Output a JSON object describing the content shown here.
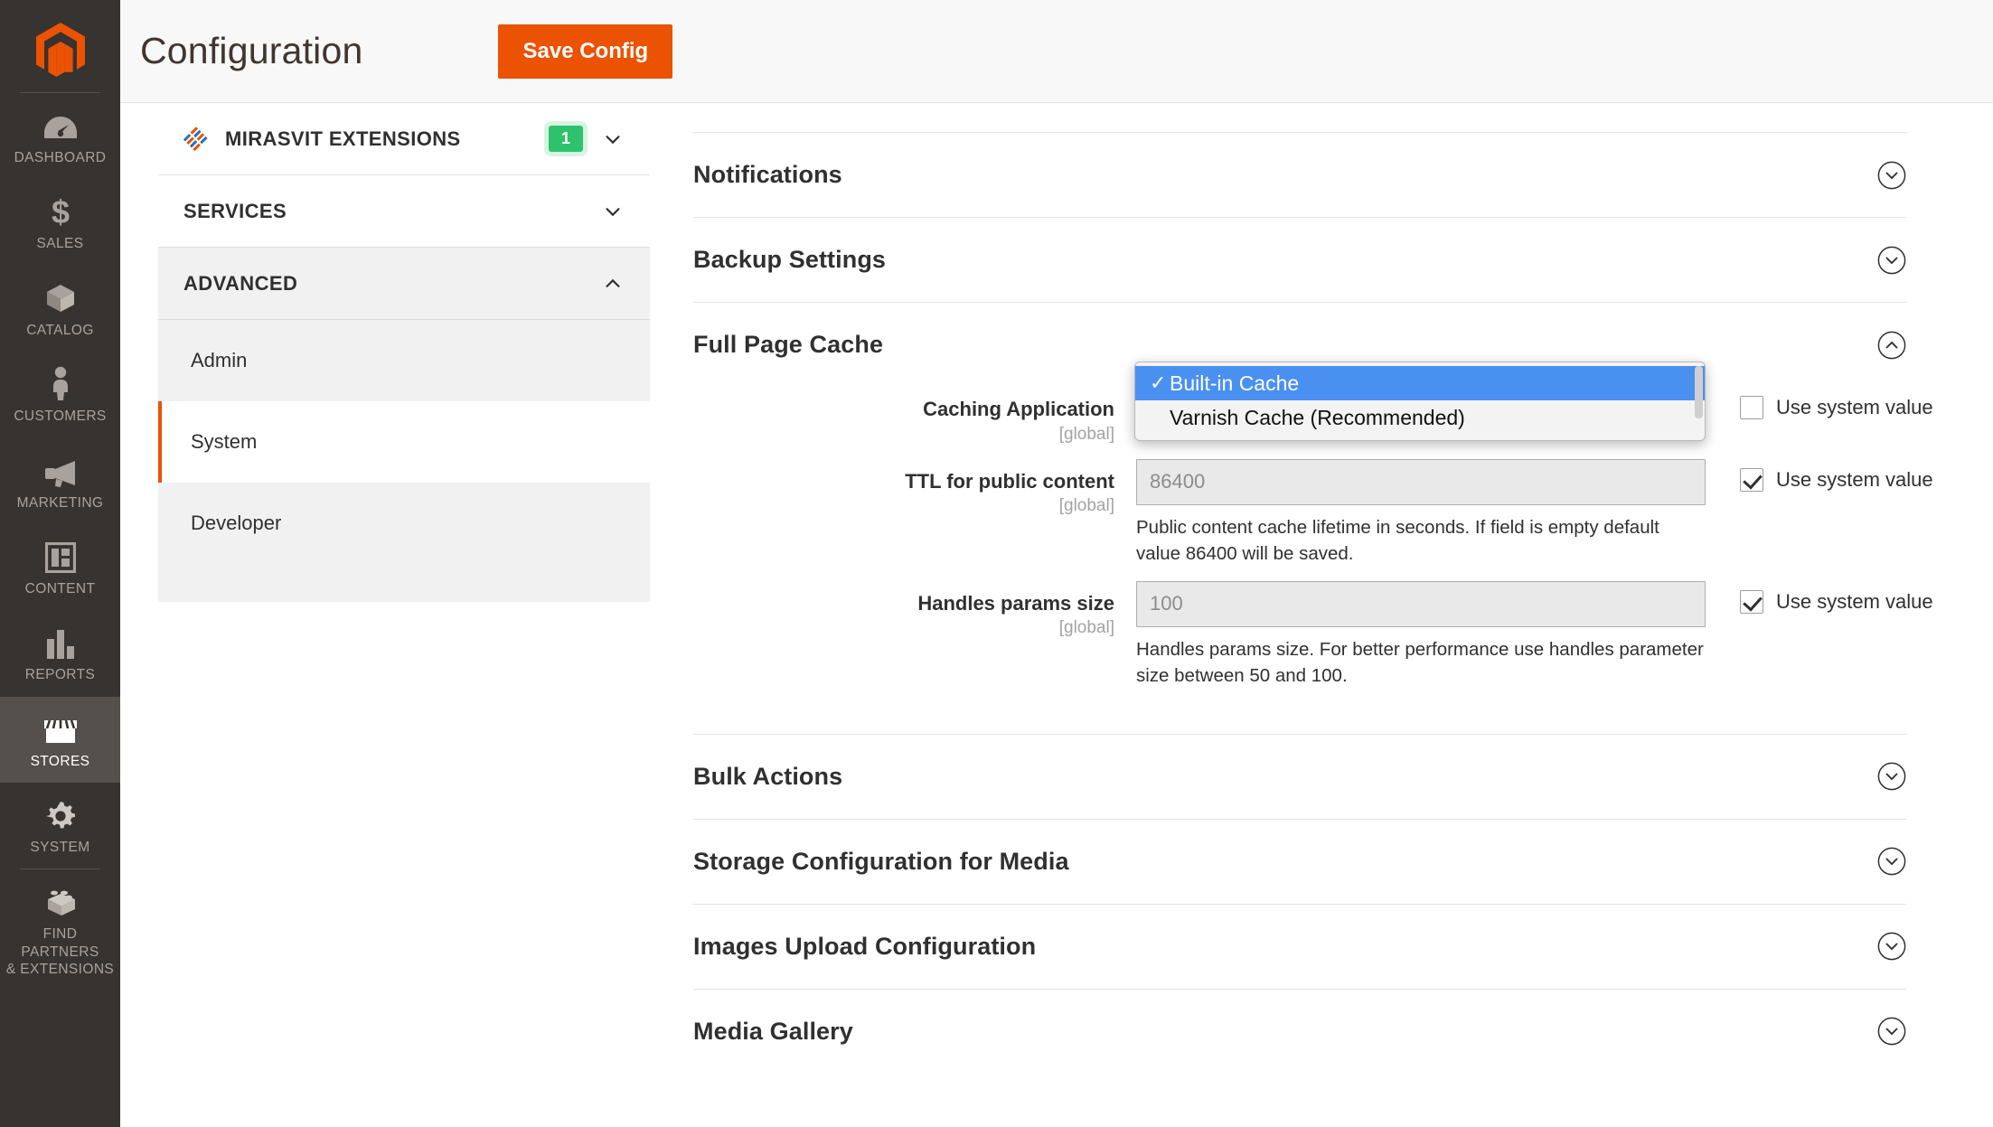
{
  "rail": {
    "logo_name": "magento-logo",
    "items": [
      {
        "label": "DASHBOARD",
        "icon": "dashboard-icon",
        "active": false
      },
      {
        "label": "SALES",
        "icon": "sales-dollar-icon",
        "active": false
      },
      {
        "label": "CATALOG",
        "icon": "catalog-box-icon",
        "active": false
      },
      {
        "label": "CUSTOMERS",
        "icon": "customers-person-icon",
        "active": false
      },
      {
        "label": "MARKETING",
        "icon": "marketing-megaphone-icon",
        "active": false
      },
      {
        "label": "CONTENT",
        "icon": "content-layout-icon",
        "active": false
      },
      {
        "label": "REPORTS",
        "icon": "reports-bars-icon",
        "active": false
      },
      {
        "label": "STORES",
        "icon": "stores-shop-icon",
        "active": true
      },
      {
        "label": "SYSTEM",
        "icon": "system-gear-icon",
        "active": false
      },
      {
        "label": "FIND PARTNERS\n& EXTENSIONS",
        "icon": "extensions-brick-icon",
        "active": false
      }
    ],
    "find_partners_line1": "FIND PARTNERS",
    "find_partners_line2": "& EXTENSIONS"
  },
  "header": {
    "title": "Configuration",
    "save_label": "Save Config"
  },
  "confnav": {
    "sections": [
      {
        "title": "MIRASVIT EXTENSIONS",
        "badge": "1",
        "state": "collapsed",
        "has_logo": true
      },
      {
        "title": "SERVICES",
        "badge": null,
        "state": "collapsed",
        "has_logo": false
      },
      {
        "title": "ADVANCED",
        "badge": null,
        "state": "expanded",
        "has_logo": false
      }
    ],
    "advanced_items": [
      {
        "label": "Admin",
        "current": false
      },
      {
        "label": "System",
        "current": true
      },
      {
        "label": "Developer",
        "current": false
      }
    ]
  },
  "main": {
    "sections": [
      {
        "title": "Notifications",
        "expanded": false
      },
      {
        "title": "Backup Settings",
        "expanded": false
      },
      {
        "title": "Full Page Cache",
        "expanded": true
      },
      {
        "title": "Bulk Actions",
        "expanded": false
      },
      {
        "title": "Storage Configuration for Media",
        "expanded": false
      },
      {
        "title": "Images Upload Configuration",
        "expanded": false
      },
      {
        "title": "Media Gallery",
        "expanded": false
      }
    ],
    "full_page_cache": {
      "caching_application": {
        "label": "Caching Application",
        "scope": "[global]",
        "selected_value": "Built-in Cache",
        "options": [
          {
            "label": "Built-in Cache",
            "selected": true
          },
          {
            "label": "Varnish Cache (Recommended)",
            "selected": false
          }
        ],
        "use_system_value_label": "Use system value",
        "use_system_value_checked": false
      },
      "ttl_public_content": {
        "label": "TTL for public content",
        "scope": "[global]",
        "value": "86400",
        "note": "Public content cache lifetime in seconds. If field is empty default value 86400 will be saved.",
        "use_system_value_label": "Use system value",
        "use_system_value_checked": true
      },
      "handles_params_size": {
        "label": "Handles params size",
        "scope": "[global]",
        "value": "100",
        "note": "Handles params size. For better performance use handles parameter size between 50 and 100.",
        "use_system_value_label": "Use system value",
        "use_system_value_checked": true
      }
    }
  },
  "colors": {
    "brand_orange": "#eb5202",
    "rail_bg": "#373330",
    "rail_active": "#55504c",
    "badge_green": "#2ec26c",
    "select_highlight": "#4a90f0"
  }
}
